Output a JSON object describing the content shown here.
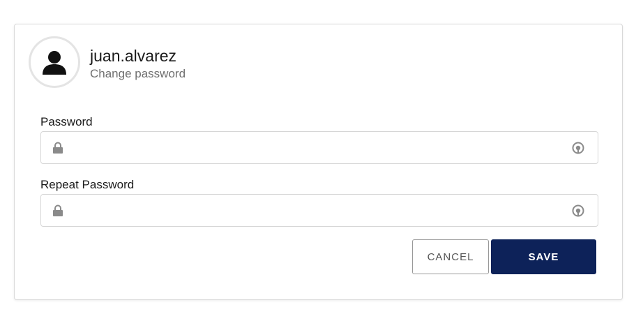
{
  "profile": {
    "username": "juan.alvarez",
    "subtitle": "Change password"
  },
  "form": {
    "password_label": "Password",
    "password_value": "",
    "repeat_label": "Repeat Password",
    "repeat_value": ""
  },
  "buttons": {
    "cancel": "CANCEL",
    "save": "SAVE"
  },
  "colors": {
    "primary": "#0d2259",
    "icon": "#8a8a8a"
  },
  "icons": {
    "avatar": "user-icon",
    "field_prefix": "lock-icon",
    "field_suffix": "eye-icon"
  }
}
